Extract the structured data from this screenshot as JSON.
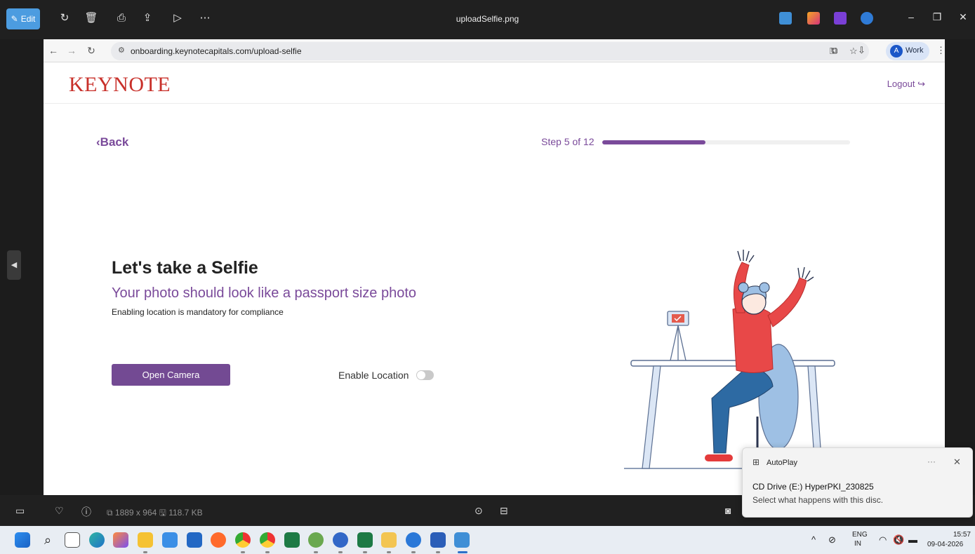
{
  "viewer": {
    "edit_label": "Edit",
    "file_name": "uploadSelfie.png",
    "toolbar_icons": [
      "rotate-icon",
      "delete-icon",
      "print-icon",
      "share-icon",
      "slideshow-icon",
      "more-icon"
    ],
    "image_dimensions": "1889 x 964",
    "file_size": "118.7 KB"
  },
  "browser": {
    "url": "onboarding.keynotecapitals.com/upload-selfie",
    "profile_initial": "A",
    "profile_label": "Work"
  },
  "page": {
    "logo": "KEYNOTE",
    "logout_label": "Logout",
    "back_label": "Back",
    "step_label": "Step 5 of 12",
    "step_current": 5,
    "step_total": 12,
    "heading": "Let's take a Selfie",
    "subheading": "Your photo should look like a passport size photo",
    "note": "Enabling location is mandatory for compliance",
    "open_camera_label": "Open Camera",
    "enable_location_label": "Enable Location",
    "location_enabled": false,
    "brand_color": "#734a93",
    "logo_color": "#c8302a"
  },
  "toast": {
    "app": "AutoPlay",
    "title": "CD Drive (E:) HyperPKI_230825",
    "body": "Select what happens with this disc."
  },
  "taskbar": {
    "lang_primary": "ENG",
    "lang_secondary": "IN",
    "time": "15:57",
    "date": "09-04-2026"
  }
}
